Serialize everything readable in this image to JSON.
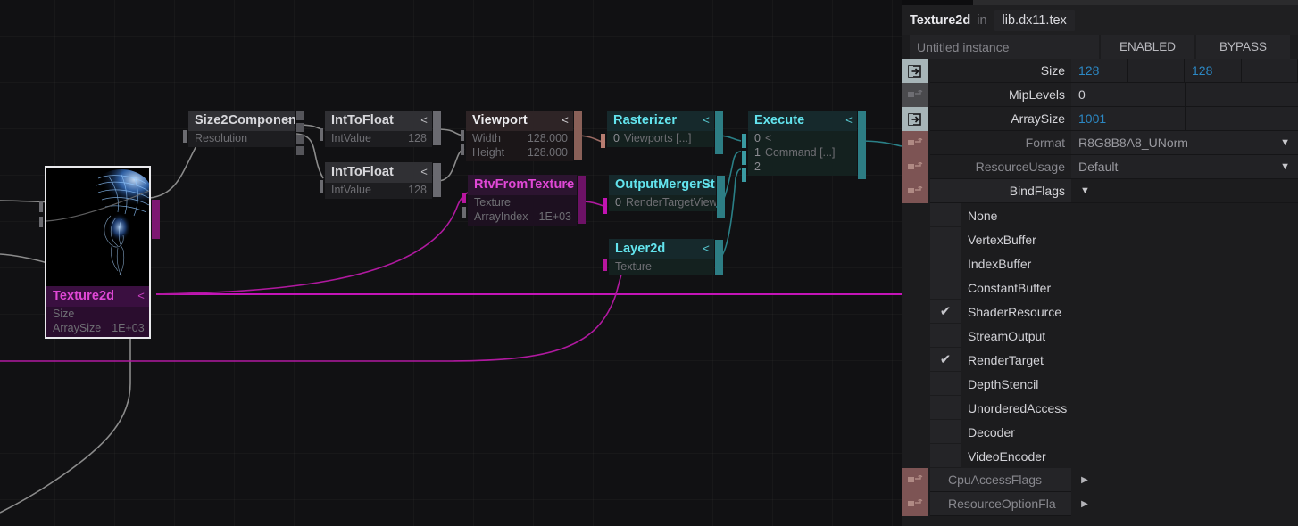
{
  "graph": {
    "nodes": [
      {
        "id": "texture2d",
        "title": "Texture2d",
        "caret": "<",
        "params": [
          {
            "k": "Size",
            "v": ""
          },
          {
            "k": "ArraySize",
            "v": "1E+03"
          }
        ]
      },
      {
        "id": "size2component",
        "title": "Size2Componen",
        "caret": "<",
        "params": [
          {
            "k": "Resolution",
            "v": ""
          }
        ]
      },
      {
        "id": "inttofloat-a",
        "title": "IntToFloat",
        "caret": "<",
        "params": [
          {
            "k": "IntValue",
            "v": "128"
          }
        ]
      },
      {
        "id": "inttofloat-b",
        "title": "IntToFloat",
        "caret": "<",
        "params": [
          {
            "k": "IntValue",
            "v": "128"
          }
        ]
      },
      {
        "id": "viewport",
        "title": "Viewport",
        "caret": "<",
        "params": [
          {
            "k": "Width",
            "v": "128.000"
          },
          {
            "k": "Height",
            "v": "128.000"
          }
        ]
      },
      {
        "id": "rtvfromtexture",
        "title": "RtvFromTexture",
        "caret": "<",
        "params": [
          {
            "k": "Texture",
            "v": ""
          },
          {
            "k": "ArrayIndex",
            "v": "1E+03"
          }
        ]
      },
      {
        "id": "rasterizer",
        "title": "Rasterizer",
        "caret": "<",
        "params": [
          {
            "num": "0",
            "k": "Viewports [...]"
          }
        ]
      },
      {
        "id": "outputmergerstate",
        "title": "OutputMergerSt",
        "caret": "<",
        "params": [
          {
            "num": "0",
            "k": "RenderTargetViews [...]"
          }
        ]
      },
      {
        "id": "layer2d",
        "title": "Layer2d",
        "caret": "<",
        "params": [
          {
            "k": "Texture",
            "v": ""
          }
        ]
      },
      {
        "id": "execute",
        "title": "Execute",
        "caret": "<",
        "params": [
          {
            "num": "0",
            "k": "<"
          },
          {
            "num": "1",
            "k": "Command [...]"
          },
          {
            "num": "2",
            "k": ""
          }
        ]
      }
    ],
    "colors": {
      "wire_gray": "#8b8b8b",
      "wire_magenta": "#c414b8",
      "wire_cyan": "#2a7f86",
      "wire_rose": "#9b6a63",
      "node_cyan_text": "#63e4ee",
      "node_magenta_text": "#e048d6",
      "grid": "#1b1b1e",
      "canvas_bg": "#111113"
    }
  },
  "panel": {
    "title": {
      "type": "Texture2d",
      "in": "in",
      "file": "lib.dx11.tex"
    },
    "instance": {
      "name_placeholder": "Untitled instance",
      "enabled_label": "ENABLED",
      "bypass_label": "BYPASS"
    },
    "properties": [
      {
        "label": "Size",
        "icon": "input-arrow-icon",
        "icon_style": "blue",
        "fields": [
          "128",
          "",
          "128",
          ""
        ],
        "numeric": [
          true,
          false,
          true,
          false
        ]
      },
      {
        "label": "MipLevels",
        "icon": "connector-icon",
        "icon_style": "dark",
        "fields": [
          "0",
          ""
        ],
        "numeric": [
          false,
          false
        ]
      },
      {
        "label": "ArraySize",
        "icon": "input-arrow-icon",
        "icon_style": "blue",
        "fields": [
          "1001",
          ""
        ],
        "numeric": [
          true,
          false
        ]
      },
      {
        "label": "Format",
        "icon": "connector-icon",
        "icon_style": "rose",
        "value": "R8G8B8A8_UNorm",
        "dropdown": true,
        "dim": true
      },
      {
        "label": "ResourceUsage",
        "icon": "connector-icon",
        "icon_style": "rose",
        "value": "Default",
        "dropdown": true,
        "dim": true
      },
      {
        "label": "BindFlags",
        "icon": "connector-icon",
        "icon_style": "rose",
        "value": "",
        "expander": true
      }
    ],
    "bind_flags": [
      {
        "label": "None",
        "checked": false
      },
      {
        "label": "VertexBuffer",
        "checked": false
      },
      {
        "label": "IndexBuffer",
        "checked": false
      },
      {
        "label": "ConstantBuffer",
        "checked": false
      },
      {
        "label": "ShaderResource",
        "checked": true
      },
      {
        "label": "StreamOutput",
        "checked": false
      },
      {
        "label": "RenderTarget",
        "checked": true
      },
      {
        "label": "DepthStencil",
        "checked": false
      },
      {
        "label": "UnorderedAccess",
        "checked": false
      },
      {
        "label": "Decoder",
        "checked": false
      },
      {
        "label": "VideoEncoder",
        "checked": false
      }
    ],
    "collapsed_rows": [
      {
        "label": "CpuAccessFlags",
        "icon": "connector-icon",
        "arrow": "▶"
      },
      {
        "label": "ResourceOptionFla",
        "icon": "connector-icon",
        "arrow": "▶"
      }
    ],
    "glyphs": {
      "check": "✔",
      "caret_down": "▼",
      "caret_right": "▶",
      "caret_left": "<"
    },
    "colors": {
      "accent_number": "#2c88c4",
      "panel_bg": "#1c1c1e",
      "row_bg": "#222225",
      "icon_blue": "#a7b5b8",
      "icon_rose": "#7d5454",
      "icon_dark": "#4a4a4d"
    }
  }
}
